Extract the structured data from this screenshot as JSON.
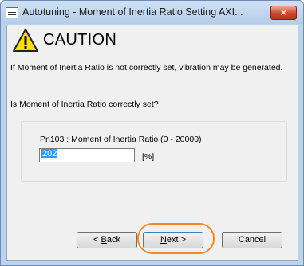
{
  "window": {
    "title": "Autotuning - Moment of Inertia Ratio Setting AXI...",
    "close_label": "✕"
  },
  "dialog": {
    "caution_title": "CAUTION",
    "message_1": "If Moment of Inertia Ratio is not correctly set, vibration may be generated.",
    "message_2": "Is Moment of Inertia Ratio correctly set?"
  },
  "parameter": {
    "label": "Pn103 : Moment of Inertia Ratio (0 - 20000)",
    "value": "202",
    "unit": "[%]"
  },
  "buttons": {
    "back_prefix": "< ",
    "back_mnemonic": "B",
    "back_rest": "ack",
    "next_mnemonic": "N",
    "next_rest": "ext >",
    "cancel_label": "Cancel"
  },
  "colors": {
    "highlight": "#f08a24",
    "warning_fill": "#ffdd00",
    "selection": "#3399ff"
  },
  "icons": {
    "warning": "warning-triangle-icon",
    "app": "app-window-icon"
  }
}
